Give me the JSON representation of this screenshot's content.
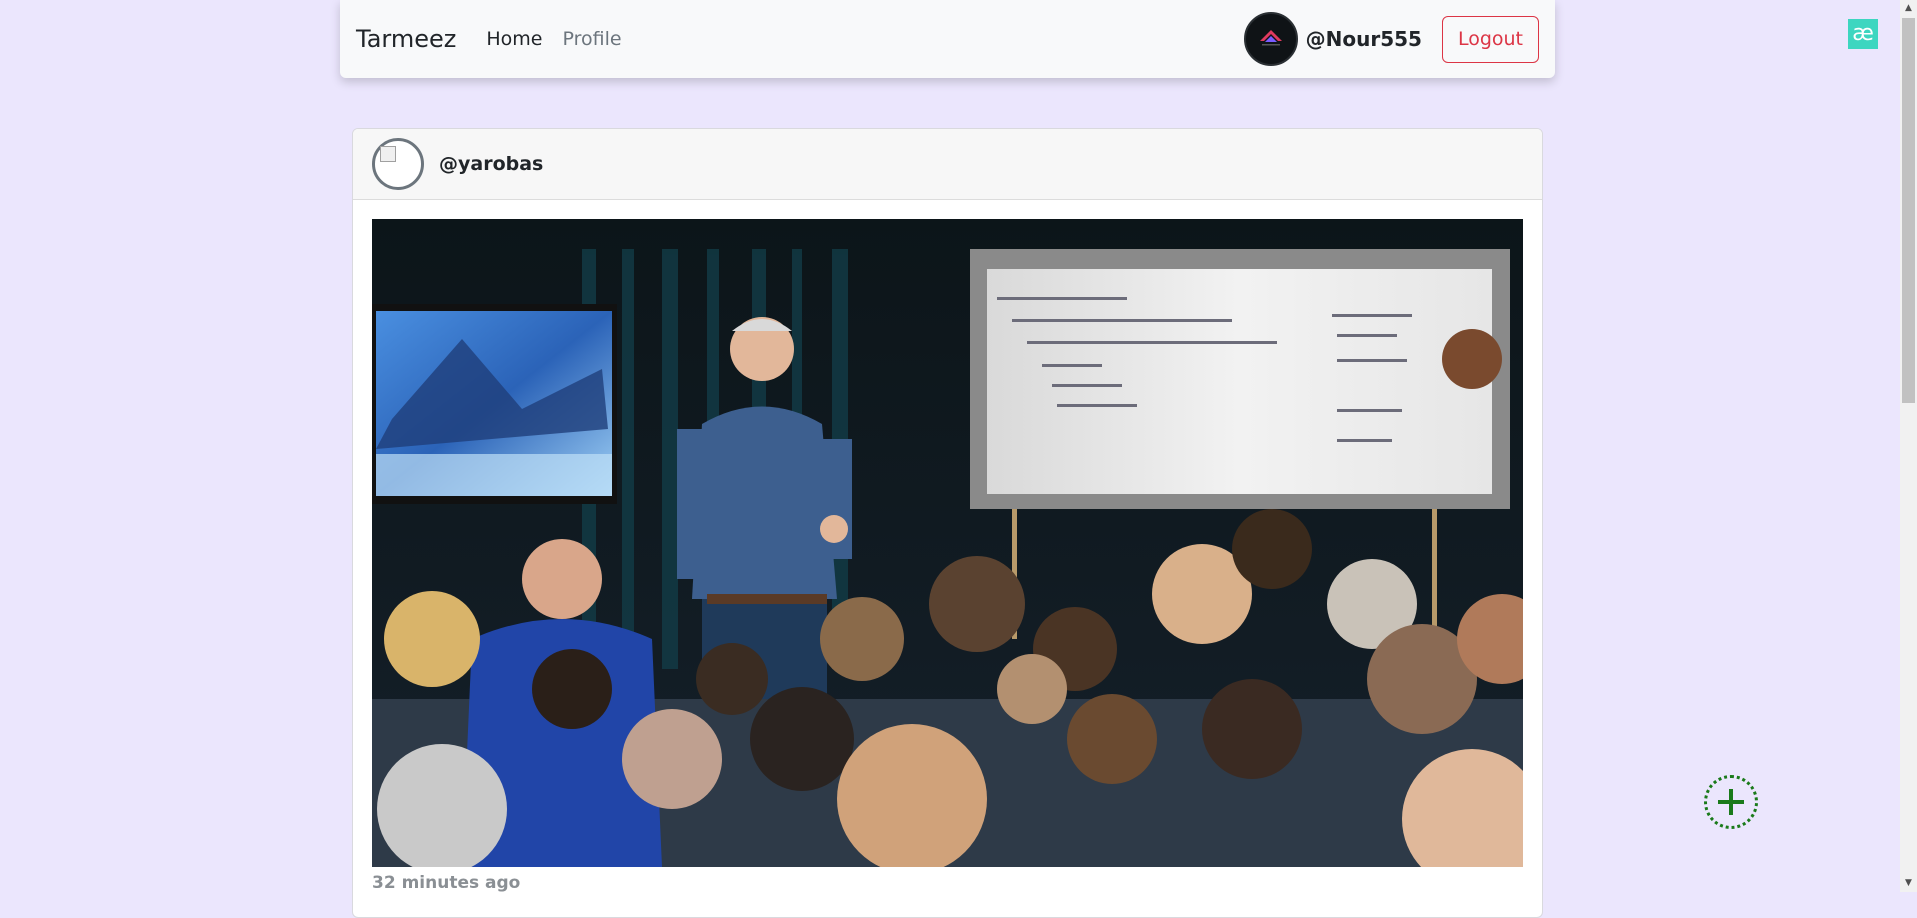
{
  "navbar": {
    "brand": "Tarmeez",
    "links": [
      {
        "label": "Home",
        "active": true
      },
      {
        "label": "Profile",
        "active": false
      }
    ],
    "username": "@Nour555",
    "logout_label": "Logout"
  },
  "extension": {
    "glyph": "æ",
    "color": "#3dd6c0"
  },
  "post": {
    "author": "@yarobas",
    "image_icon": "presentation-photo",
    "time_ago": "32 minutes ago"
  },
  "fab": {
    "icon": "plus-icon",
    "color": "#1a7a1a"
  },
  "colors": {
    "background": "#ebe6fd",
    "danger": "#dc3545",
    "muted": "#6c757d"
  }
}
